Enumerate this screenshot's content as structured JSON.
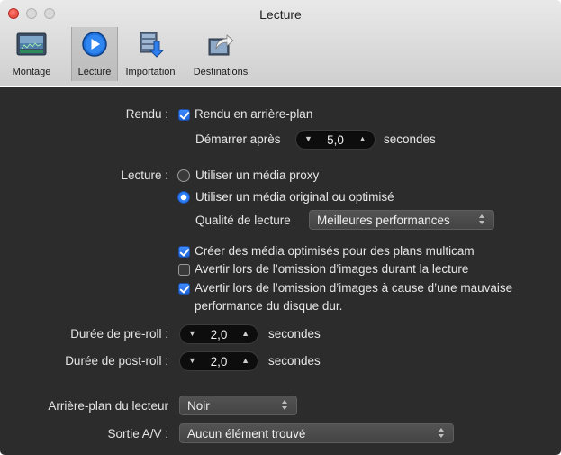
{
  "window": {
    "title": "Lecture"
  },
  "toolbar": {
    "items": [
      {
        "label": "Montage",
        "icon": "film-strip-icon"
      },
      {
        "label": "Lecture",
        "icon": "play-icon",
        "selected": true
      },
      {
        "label": "Importation",
        "icon": "import-icon"
      },
      {
        "label": "Destinations",
        "icon": "share-icon"
      }
    ]
  },
  "rendu": {
    "label": "Rendu :",
    "background_render": {
      "label": "Rendu en arrière-plan",
      "checked": true
    },
    "start_after_label": "Démarrer après",
    "start_after_value": "5,0",
    "seconds": "secondes"
  },
  "lecture": {
    "label": "Lecture :",
    "proxy": {
      "label": "Utiliser un média proxy",
      "selected": false
    },
    "original": {
      "label": "Utiliser un média original ou optimisé",
      "selected": true
    },
    "quality_label": "Qualité de lecture",
    "quality_value": "Meilleures performances",
    "multicam": {
      "label": "Créer des média optimisés pour des plans multicam",
      "checked": true
    },
    "warn_drop": {
      "label": "Avertir lors de l’omission d’images durant la lecture",
      "checked": false
    },
    "warn_disk": {
      "line1": "Avertir lors de l’omission d’images à cause d’une mauvaise",
      "line2": "performance du disque dur.",
      "checked": true
    }
  },
  "preroll": {
    "label": "Durée de pre-roll :",
    "value": "2,0",
    "unit": "secondes"
  },
  "postroll": {
    "label": "Durée de post-roll :",
    "value": "2,0",
    "unit": "secondes"
  },
  "player_bg": {
    "label": "Arrière-plan du lecteur",
    "value": "Noir"
  },
  "av_output": {
    "label": "Sortie A/V :",
    "value": "Aucun élément trouvé"
  },
  "colors": {
    "accent": "#2c7cf5",
    "panel": "#2c2c2c",
    "toolbar": "#d9d9d9"
  }
}
